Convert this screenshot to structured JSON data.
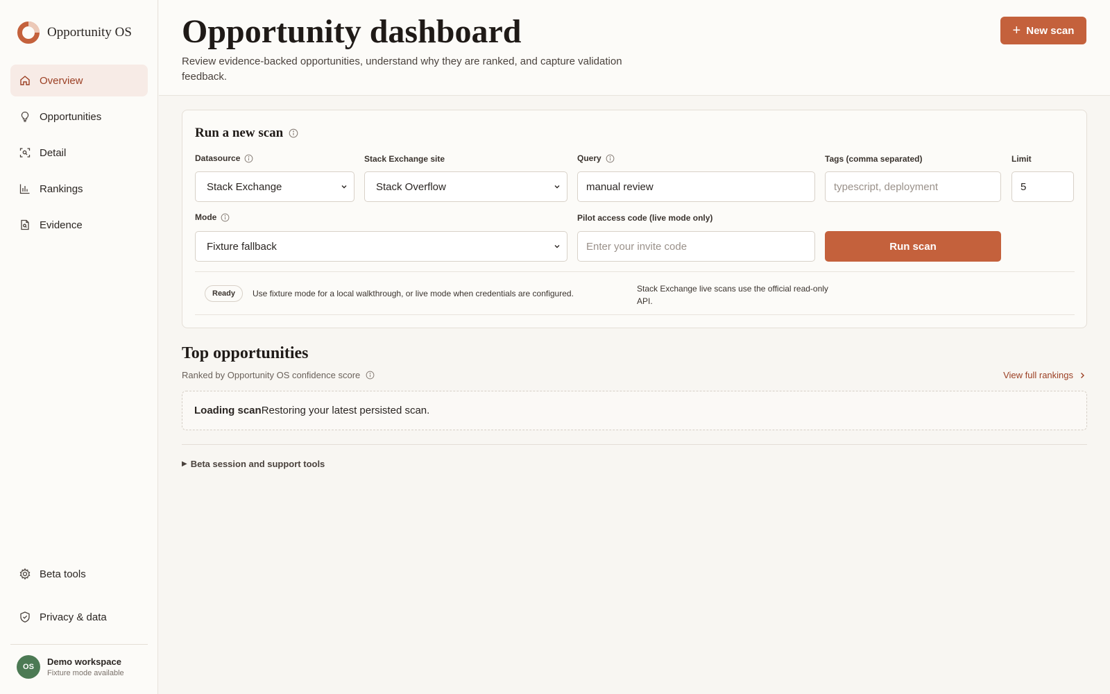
{
  "brand": {
    "name": "Opportunity OS",
    "accent": "#c4613c"
  },
  "sidebar": {
    "items": [
      {
        "label": "Overview",
        "icon": "home-icon",
        "active": true
      },
      {
        "label": "Opportunities",
        "icon": "lightbulb-icon"
      },
      {
        "label": "Detail",
        "icon": "scan-detail-icon"
      },
      {
        "label": "Rankings",
        "icon": "bar-chart-icon"
      },
      {
        "label": "Evidence",
        "icon": "document-search-icon"
      }
    ],
    "bottom_items": [
      {
        "label": "Beta tools",
        "icon": "gear-icon"
      },
      {
        "label": "Privacy & data",
        "icon": "shield-icon"
      }
    ],
    "workspace": {
      "initials": "OS",
      "name": "Demo workspace",
      "subtitle": "Fixture mode available"
    }
  },
  "header": {
    "title": "Opportunity dashboard",
    "subtitle": "Review evidence-backed opportunities, understand why they are ranked, and capture validation feedback.",
    "new_scan_label": "New scan"
  },
  "scan_form": {
    "title": "Run a new scan",
    "datasource": {
      "label": "Datasource",
      "value": "Stack Exchange"
    },
    "site": {
      "label": "Stack Exchange site",
      "value": "Stack Overflow"
    },
    "query": {
      "label": "Query",
      "value": "manual review"
    },
    "tags": {
      "label": "Tags (comma separated)",
      "placeholder": "typescript, deployment"
    },
    "limit": {
      "label": "Limit",
      "value": "5"
    },
    "mode": {
      "label": "Mode",
      "value": "Fixture fallback"
    },
    "access_code": {
      "label": "Pilot access code (live mode only)",
      "placeholder": "Enter your invite code"
    },
    "run_label": "Run scan",
    "status": {
      "badge": "Ready",
      "message": "Use fixture mode for a local walkthrough, or live mode when credentials are configured.",
      "live_note": "Stack Exchange live scans use the official read-only API."
    }
  },
  "top_opportunities": {
    "title": "Top opportunities",
    "subtitle": "Ranked by Opportunity OS confidence score",
    "view_all_label": "View full rankings",
    "loading_title": "Loading scan",
    "loading_message": "Restoring your latest persisted scan."
  },
  "beta_section": {
    "label": "Beta session and support tools"
  }
}
